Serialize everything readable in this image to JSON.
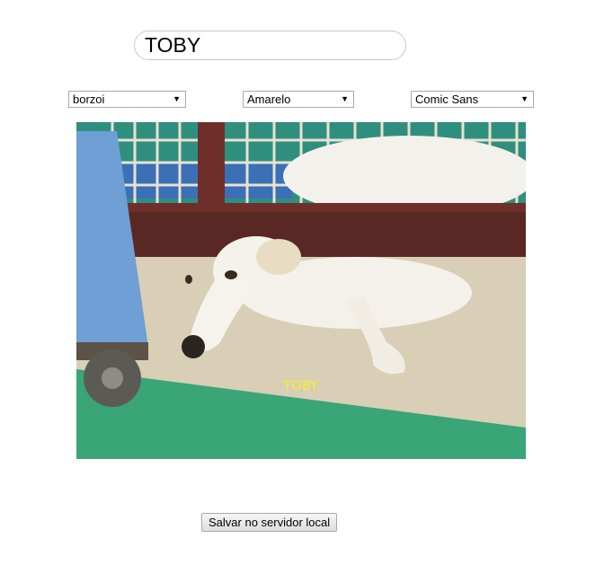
{
  "name_field": {
    "value": "TOBY"
  },
  "selects": {
    "breed": {
      "value": "borzoi"
    },
    "color": {
      "value": "Amarelo"
    },
    "font": {
      "value": "Comic Sans"
    }
  },
  "image": {
    "subject": "dog-photo",
    "caption": "TOBY",
    "caption_color": "#ffee22"
  },
  "actions": {
    "save_label": "Salvar no servidor local"
  },
  "icons": {
    "dropdown": "chevron-down-icon"
  }
}
